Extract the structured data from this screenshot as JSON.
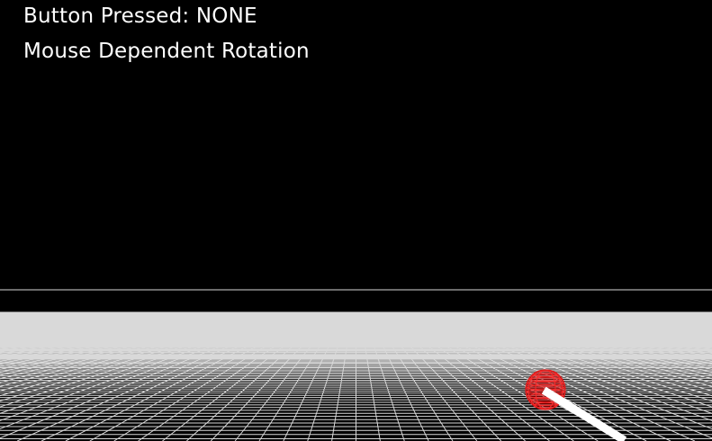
{
  "hud": {
    "button_label": "Button Pressed:",
    "button_value": "NONE",
    "mode_text": "Mouse Dependent Rotation"
  },
  "scene": {
    "background_color": "#000000",
    "grid_color": "#ffffff",
    "ball_color": "#cc0000",
    "stick_color": "#ffffff",
    "icons": [
      "grid-floor",
      "wireframe-sphere",
      "stick-handle"
    ]
  }
}
